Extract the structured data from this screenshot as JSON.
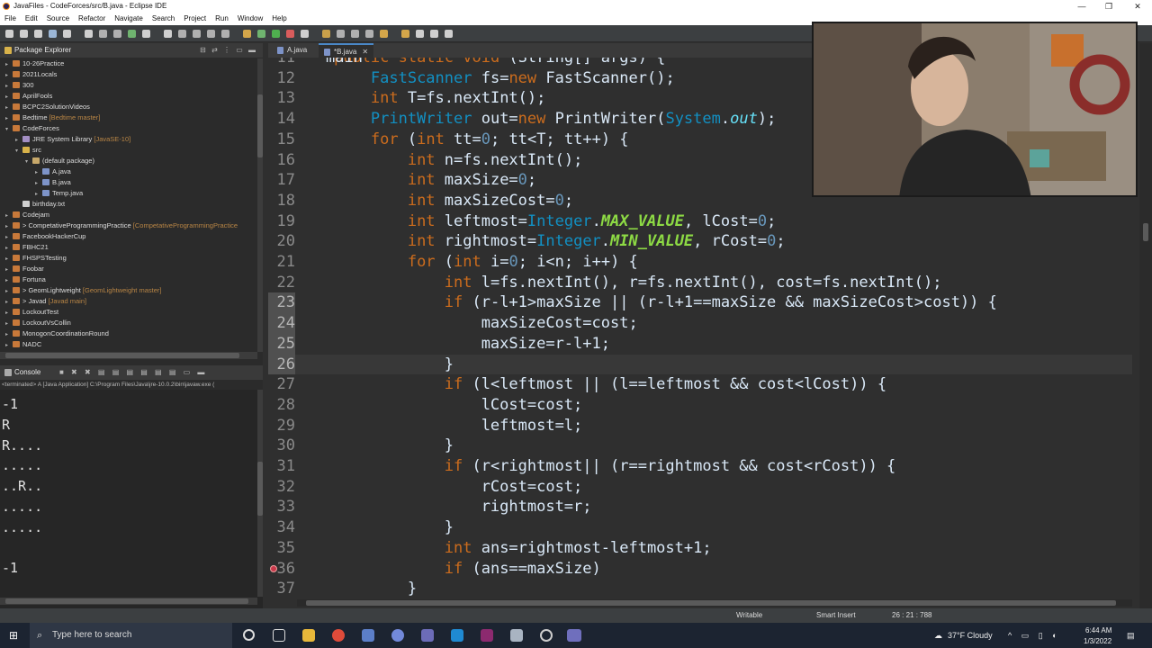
{
  "window": {
    "title": "JavaFiles - CodeForces/src/B.java - Eclipse IDE",
    "minimize_icon": "—",
    "maximize_icon": "❐",
    "close_icon": "✕"
  },
  "menu": [
    "File",
    "Edit",
    "Source",
    "Refactor",
    "Navigate",
    "Search",
    "Project",
    "Run",
    "Window",
    "Help"
  ],
  "explorer": {
    "title": "Package Explorer",
    "items": [
      {
        "label": "10-26Practice",
        "indent": 0,
        "icon": "project",
        "twisty": "▸",
        "deco": ""
      },
      {
        "label": "2021Locals",
        "indent": 0,
        "icon": "project",
        "twisty": "▸",
        "deco": ""
      },
      {
        "label": "300",
        "indent": 0,
        "icon": "project",
        "twisty": "▸",
        "deco": ""
      },
      {
        "label": "AprilFools",
        "indent": 0,
        "icon": "project",
        "twisty": "▸",
        "deco": ""
      },
      {
        "label": "BCPC2SolutionVideos",
        "indent": 0,
        "icon": "project",
        "twisty": "▸",
        "deco": ""
      },
      {
        "label": "Bedtime",
        "indent": 0,
        "icon": "project",
        "twisty": "▸",
        "deco": "[Bedtime master]"
      },
      {
        "label": "CodeForces",
        "indent": 0,
        "icon": "project",
        "twisty": "▾",
        "deco": ""
      },
      {
        "label": "JRE System Library",
        "indent": 1,
        "icon": "library",
        "twisty": "▸",
        "deco": "[JavaSE-10]"
      },
      {
        "label": "src",
        "indent": 1,
        "icon": "folder",
        "twisty": "▾",
        "deco": ""
      },
      {
        "label": "(default package)",
        "indent": 2,
        "icon": "package",
        "twisty": "▾",
        "deco": ""
      },
      {
        "label": "A.java",
        "indent": 3,
        "icon": "java",
        "twisty": "▸",
        "deco": ""
      },
      {
        "label": "B.java",
        "indent": 3,
        "icon": "java",
        "twisty": "▸",
        "deco": ""
      },
      {
        "label": "Temp.java",
        "indent": 3,
        "icon": "java",
        "twisty": "▸",
        "deco": ""
      },
      {
        "label": "birthday.txt",
        "indent": 1,
        "icon": "file",
        "twisty": "",
        "deco": ""
      },
      {
        "label": "Codejam",
        "indent": 0,
        "icon": "project",
        "twisty": "▸",
        "deco": ""
      },
      {
        "label": "> CompetativeProgrammingPractice",
        "indent": 0,
        "icon": "project",
        "twisty": "▸",
        "deco": "[CompetativeProgrammingPractice"
      },
      {
        "label": "FacebookHackerCup",
        "indent": 0,
        "icon": "project",
        "twisty": "▸",
        "deco": ""
      },
      {
        "label": "FBHC21",
        "indent": 0,
        "icon": "project",
        "twisty": "▸",
        "deco": ""
      },
      {
        "label": "FHSPSTesting",
        "indent": 0,
        "icon": "project",
        "twisty": "▸",
        "deco": ""
      },
      {
        "label": "Foobar",
        "indent": 0,
        "icon": "project",
        "twisty": "▸",
        "deco": ""
      },
      {
        "label": "Fortuna",
        "indent": 0,
        "icon": "project",
        "twisty": "▸",
        "deco": ""
      },
      {
        "label": "> GeomLightweight",
        "indent": 0,
        "icon": "project",
        "twisty": "▸",
        "deco": "[GeomLightweight master]"
      },
      {
        "label": "> Javad",
        "indent": 0,
        "icon": "project",
        "twisty": "▸",
        "deco": "[Javad main]"
      },
      {
        "label": "LockoutTest",
        "indent": 0,
        "icon": "project",
        "twisty": "▸",
        "deco": ""
      },
      {
        "label": "LockoutVsCollin",
        "indent": 0,
        "icon": "project",
        "twisty": "▸",
        "deco": ""
      },
      {
        "label": "MonogonCoordinationRound",
        "indent": 0,
        "icon": "project",
        "twisty": "▸",
        "deco": ""
      },
      {
        "label": "NADC",
        "indent": 0,
        "icon": "project",
        "twisty": "▸",
        "deco": ""
      }
    ]
  },
  "console": {
    "title": "Console",
    "terminated": "<terminated> A [Java Application] C:\\Program Files\\Java\\jre-10.0.2\\bin\\javaw.exe (",
    "lines": [
      "-1",
      "R",
      "R....",
      ".....",
      "..R..",
      ".....",
      ".....",
      "",
      "-1"
    ]
  },
  "editor": {
    "tabs": [
      {
        "label": "A.java",
        "active": false
      },
      {
        "label": "*B.java",
        "active": true
      }
    ],
    "tab_close": "✕",
    "current_line": 26,
    "selected_lines": [
      23,
      24,
      25,
      26
    ],
    "error_line": 36,
    "lines": [
      {
        "n": "11",
        "s": [
          [
            "    ",
            ""
          ],
          [
            "public static void ",
            "kw"
          ],
          [
            "main",
            "tx"
          ],
          [
            "(String[] args) {",
            ""
          ]
        ]
      },
      {
        "n": "12",
        "s": [
          [
            "        ",
            ""
          ],
          [
            "FastScanner",
            "ty"
          ],
          [
            " fs=",
            ""
          ],
          [
            "new",
            "kw"
          ],
          [
            " FastScanner();",
            ""
          ]
        ]
      },
      {
        "n": "13",
        "s": [
          [
            "        ",
            ""
          ],
          [
            "int",
            "kw"
          ],
          [
            " T=fs.nextInt();",
            ""
          ]
        ]
      },
      {
        "n": "14",
        "s": [
          [
            "        ",
            ""
          ],
          [
            "PrintWriter",
            "ty"
          ],
          [
            " out=",
            ""
          ],
          [
            "new",
            "kw"
          ],
          [
            " PrintWriter(",
            ""
          ],
          [
            "System",
            "ty"
          ],
          [
            ".",
            ""
          ],
          [
            "out",
            "fld"
          ],
          [
            ");",
            ""
          ]
        ]
      },
      {
        "n": "15",
        "s": [
          [
            "        ",
            ""
          ],
          [
            "for",
            "kw"
          ],
          [
            " (",
            ""
          ],
          [
            "int",
            "kw"
          ],
          [
            " tt=",
            ""
          ],
          [
            "0",
            "num"
          ],
          [
            "; tt<T; tt++) {",
            ""
          ]
        ]
      },
      {
        "n": "16",
        "s": [
          [
            "            ",
            ""
          ],
          [
            "int",
            "kw"
          ],
          [
            " n=fs.nextInt();",
            ""
          ]
        ]
      },
      {
        "n": "17",
        "s": [
          [
            "            ",
            ""
          ],
          [
            "int",
            "kw"
          ],
          [
            " maxSize=",
            ""
          ],
          [
            "0",
            "num"
          ],
          [
            ";",
            ""
          ]
        ]
      },
      {
        "n": "18",
        "s": [
          [
            "            ",
            ""
          ],
          [
            "int",
            "kw"
          ],
          [
            " maxSizeCost=",
            ""
          ],
          [
            "0",
            "num"
          ],
          [
            ";",
            ""
          ]
        ]
      },
      {
        "n": "19",
        "s": [
          [
            "            ",
            ""
          ],
          [
            "int",
            "kw"
          ],
          [
            " leftmost=",
            ""
          ],
          [
            "Integer",
            "ty"
          ],
          [
            ".",
            ""
          ],
          [
            "MAX_VALUE",
            "st"
          ],
          [
            ", lCost=",
            ""
          ],
          [
            "0",
            "num"
          ],
          [
            ";",
            ""
          ]
        ]
      },
      {
        "n": "20",
        "s": [
          [
            "            ",
            ""
          ],
          [
            "int",
            "kw"
          ],
          [
            " rightmost=",
            ""
          ],
          [
            "Integer",
            "ty"
          ],
          [
            ".",
            ""
          ],
          [
            "MIN_VALUE",
            "st"
          ],
          [
            ", rCost=",
            ""
          ],
          [
            "0",
            "num"
          ],
          [
            ";",
            ""
          ]
        ]
      },
      {
        "n": "21",
        "s": [
          [
            "            ",
            ""
          ],
          [
            "for",
            "kw"
          ],
          [
            " (",
            ""
          ],
          [
            "int",
            "kw"
          ],
          [
            " i=",
            ""
          ],
          [
            "0",
            "num"
          ],
          [
            "; i<n; i++) {",
            ""
          ]
        ]
      },
      {
        "n": "22",
        "s": [
          [
            "                ",
            ""
          ],
          [
            "int",
            "kw"
          ],
          [
            " l=fs.nextInt(), r=fs.nextInt(), cost=fs.nextInt();",
            ""
          ]
        ]
      },
      {
        "n": "23",
        "s": [
          [
            "                ",
            ""
          ],
          [
            "if",
            "kw"
          ],
          [
            " (r-l+1>maxSize || (r-l+1==maxSize && maxSizeCost>cost)) {",
            ""
          ]
        ]
      },
      {
        "n": "24",
        "s": [
          [
            "                    maxSizeCost=cost;",
            ""
          ]
        ]
      },
      {
        "n": "25",
        "s": [
          [
            "                    maxSize=r-l+1;",
            ""
          ]
        ]
      },
      {
        "n": "26",
        "s": [
          [
            "                }",
            ""
          ]
        ]
      },
      {
        "n": "27",
        "s": [
          [
            "                ",
            ""
          ],
          [
            "if",
            "kw"
          ],
          [
            " (l<leftmost || (l==leftmost && cost<lCost)) {",
            ""
          ]
        ]
      },
      {
        "n": "28",
        "s": [
          [
            "                    lCost=cost;",
            ""
          ]
        ]
      },
      {
        "n": "29",
        "s": [
          [
            "                    leftmost=l;",
            ""
          ]
        ]
      },
      {
        "n": "30",
        "s": [
          [
            "                }",
            ""
          ]
        ]
      },
      {
        "n": "31",
        "s": [
          [
            "                ",
            ""
          ],
          [
            "if",
            "kw"
          ],
          [
            " (r<rightmost|| (r==rightmost && cost<rCost)) {",
            ""
          ]
        ]
      },
      {
        "n": "32",
        "s": [
          [
            "                    rCost=cost;",
            ""
          ]
        ]
      },
      {
        "n": "33",
        "s": [
          [
            "                    rightmost=r;",
            ""
          ]
        ]
      },
      {
        "n": "34",
        "s": [
          [
            "                }",
            ""
          ]
        ]
      },
      {
        "n": "35",
        "s": [
          [
            "                ",
            ""
          ],
          [
            "int",
            "kw"
          ],
          [
            " ans=rightmost-leftmost+1;",
            ""
          ]
        ]
      },
      {
        "n": "36",
        "s": [
          [
            "                ",
            ""
          ],
          [
            "if",
            "kw"
          ],
          [
            " (ans==maxSize)",
            ""
          ]
        ]
      },
      {
        "n": "37",
        "s": [
          [
            "            }",
            ""
          ]
        ]
      }
    ]
  },
  "status": {
    "writable": "Writable",
    "insert_mode": "Smart Insert",
    "position": "26 : 21 : 788"
  },
  "taskbar": {
    "search_placeholder": "Type here to search",
    "weather": "37°F  Cloudy",
    "time": "6:44 AM",
    "date": "1/3/2022"
  },
  "colors": {
    "keyword": "#cc6c1d",
    "type": "#1290c3",
    "number": "#6897bb",
    "static_field": "#8dda44",
    "field": "#66e1f8",
    "plain": "#d9e8f7"
  }
}
